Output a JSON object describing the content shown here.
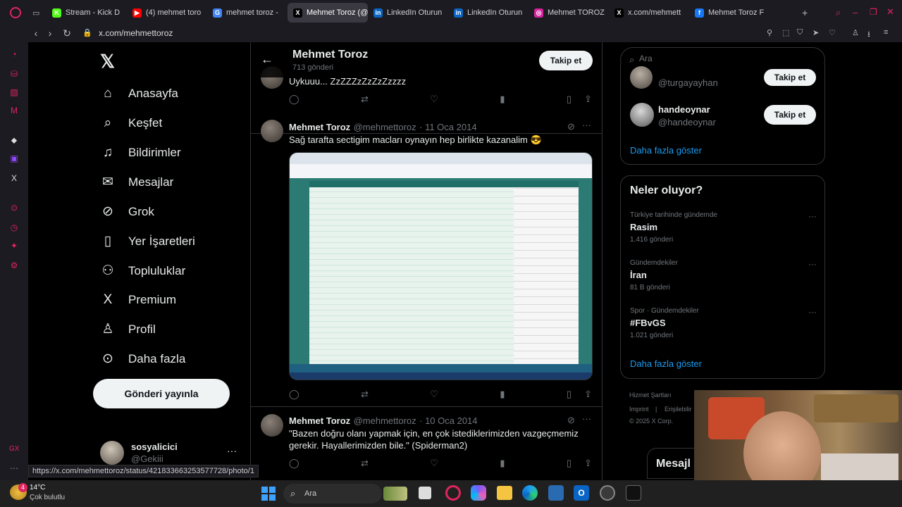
{
  "browser": {
    "tabs": [
      {
        "label": "Stream - Kick D",
        "color": "#53fc18",
        "glyph": "K"
      },
      {
        "label": "(4) mehmet toro",
        "color": "#ff0000",
        "glyph": "▶"
      },
      {
        "label": "mehmet toroz -",
        "color": "#4285f4",
        "glyph": "G"
      },
      {
        "label": "Mehmet Toroz (@mehme",
        "color": "#000000",
        "glyph": "X",
        "active": true
      },
      {
        "label": "LinkedIn Oturun",
        "color": "#0a66c2",
        "glyph": "in"
      },
      {
        "label": "LinkedIn Oturun",
        "color": "#0a66c2",
        "glyph": "in"
      },
      {
        "label": "Mehmet TOROZ",
        "color": "#d6249f",
        "glyph": "◎"
      },
      {
        "label": "x.com/mehmett",
        "color": "#000000",
        "glyph": "X"
      },
      {
        "label": "Mehmet Toroz F",
        "color": "#1877f2",
        "glyph": "f"
      }
    ],
    "url": "x.com/mehmettoroz",
    "status_url": "https://x.com/mehmettoroz/status/421833663253577728/photo/1"
  },
  "sidebar": {
    "nav": [
      {
        "label": "Anasayfa",
        "icon": "home-icon",
        "glyph": "⌂"
      },
      {
        "label": "Keşfet",
        "icon": "search-icon",
        "glyph": "⌕"
      },
      {
        "label": "Bildirimler",
        "icon": "bell-icon",
        "glyph": "♫"
      },
      {
        "label": "Mesajlar",
        "icon": "mail-icon",
        "glyph": "✉"
      },
      {
        "label": "Grok",
        "icon": "grok-icon",
        "glyph": "⊘"
      },
      {
        "label": "Yer İşaretleri",
        "icon": "bookmark-icon",
        "glyph": "▯"
      },
      {
        "label": "Topluluklar",
        "icon": "communities-icon",
        "glyph": "⚇"
      },
      {
        "label": "Premium",
        "icon": "x-logo-icon",
        "glyph": "X"
      },
      {
        "label": "Profil",
        "icon": "profile-icon",
        "glyph": "♙"
      },
      {
        "label": "Daha fazla",
        "icon": "more-circle-icon",
        "glyph": "⊙"
      }
    ],
    "post_button": "Gönderi yayınla",
    "account": {
      "name": "sosyalicici",
      "handle": "@Gekiii"
    }
  },
  "profile_header": {
    "name": "Mehmet Toroz",
    "post_count": "713 gönderi",
    "follow_label": "Takip et"
  },
  "tweets": [
    {
      "text": "Uykuuu... ZzZZZzZzZzZzzzz"
    },
    {
      "name": "Mehmet Toroz",
      "handle": "@mehmettoroz",
      "date": "· 11 Oca 2014",
      "text": "Sağ tarafta sectigim macları oynayın hep birlikte kazanalim 😎"
    },
    {
      "name": "Mehmet Toroz",
      "handle": "@mehmettoroz",
      "date": "· 10 Oca 2014",
      "text": "\"Bazen doğru olanı yapmak için, en çok istediklerimizden vazgeçmemiz gerekir. Hayallerimizden bile.\" (Spiderman2)"
    }
  ],
  "right": {
    "search_placeholder": "Ara",
    "follow_suggestions": [
      {
        "handle": "@turgayayhan",
        "follow_label": "Takip et"
      },
      {
        "name": "handeoynar",
        "handle": "@handeoynar",
        "follow_label": "Takip et"
      }
    ],
    "show_more": "Daha fazla göster",
    "trends_title": "Neler oluyor?",
    "trends": [
      {
        "meta": "Türkiye tarihinde gündemde",
        "name": "Rasim",
        "count": "1.416 gönderi"
      },
      {
        "meta": "Gündemdekiler",
        "name": "İran",
        "count": "81 B gönderi"
      },
      {
        "meta": "Spor · Gündemdekiler",
        "name": "#FBvGS",
        "count": "1.021 gönderi"
      }
    ],
    "trends_more": "Daha fazla göster",
    "footer": [
      "Hizmet Şartları",
      "Imprint",
      "Erişilebilir",
      "© 2025 X Corp."
    ],
    "messages_label": "Mesajl"
  },
  "taskbar": {
    "weather_temp": "14°C",
    "weather_desc": "Çok bulutlu",
    "badge": "4",
    "search_label": "Ara"
  }
}
